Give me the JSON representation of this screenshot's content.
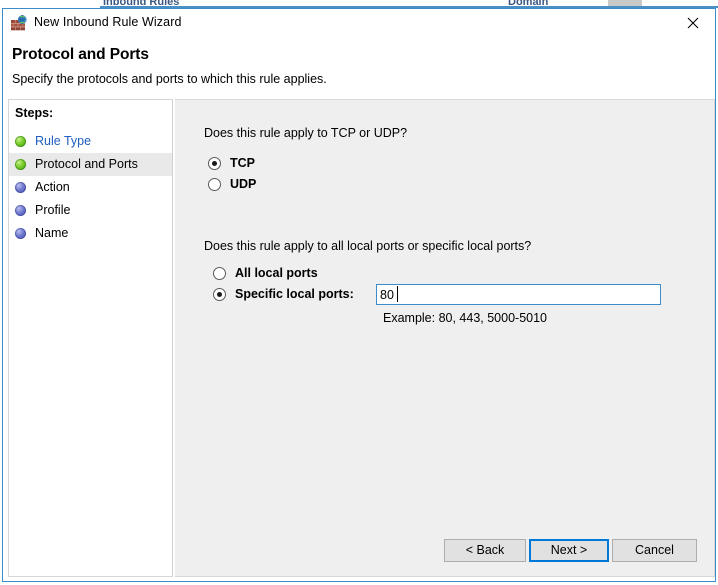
{
  "background_window": {
    "row_left_text": "Inbound Rules",
    "row_right_text": "Domain"
  },
  "window": {
    "title": "New Inbound Rule Wizard",
    "icon": "firewall-globe-icon",
    "close_label": "Close"
  },
  "header": {
    "title": "Protocol and Ports",
    "subtitle": "Specify the protocols and ports to which this rule applies."
  },
  "sidebar": {
    "label": "Steps:",
    "items": [
      {
        "label": "Rule Type",
        "state": "done",
        "current": false,
        "bullet": "green-bullet-icon"
      },
      {
        "label": "Protocol and Ports",
        "state": "done",
        "current": true,
        "bullet": "green-bullet-icon"
      },
      {
        "label": "Action",
        "state": "pending",
        "current": false,
        "bullet": "blue-bullet-icon"
      },
      {
        "label": "Profile",
        "state": "pending",
        "current": false,
        "bullet": "blue-bullet-icon"
      },
      {
        "label": "Name",
        "state": "pending",
        "current": false,
        "bullet": "blue-bullet-icon"
      }
    ]
  },
  "main": {
    "protocol_question": "Does this rule apply to TCP or UDP?",
    "protocol_options": [
      {
        "label": "TCP",
        "checked": true
      },
      {
        "label": "UDP",
        "checked": false
      }
    ],
    "ports_question": "Does this rule apply to all local ports or specific local ports?",
    "ports_options": [
      {
        "label": "All local ports",
        "checked": false
      },
      {
        "label": "Specific local ports:",
        "checked": true
      }
    ],
    "port_value": "80",
    "port_placeholder": "",
    "example_text": "Example: 80, 443, 5000-5010"
  },
  "footer": {
    "back_label": "< Back",
    "next_label": "Next >",
    "cancel_label": "Cancel"
  },
  "colors": {
    "accent": "#0078d7",
    "window_border": "#3c8ccc",
    "panel_background": "#efefef",
    "link": "#1f5dc0",
    "step_done": "#76cc2a",
    "step_pending": "#6f79cf"
  }
}
